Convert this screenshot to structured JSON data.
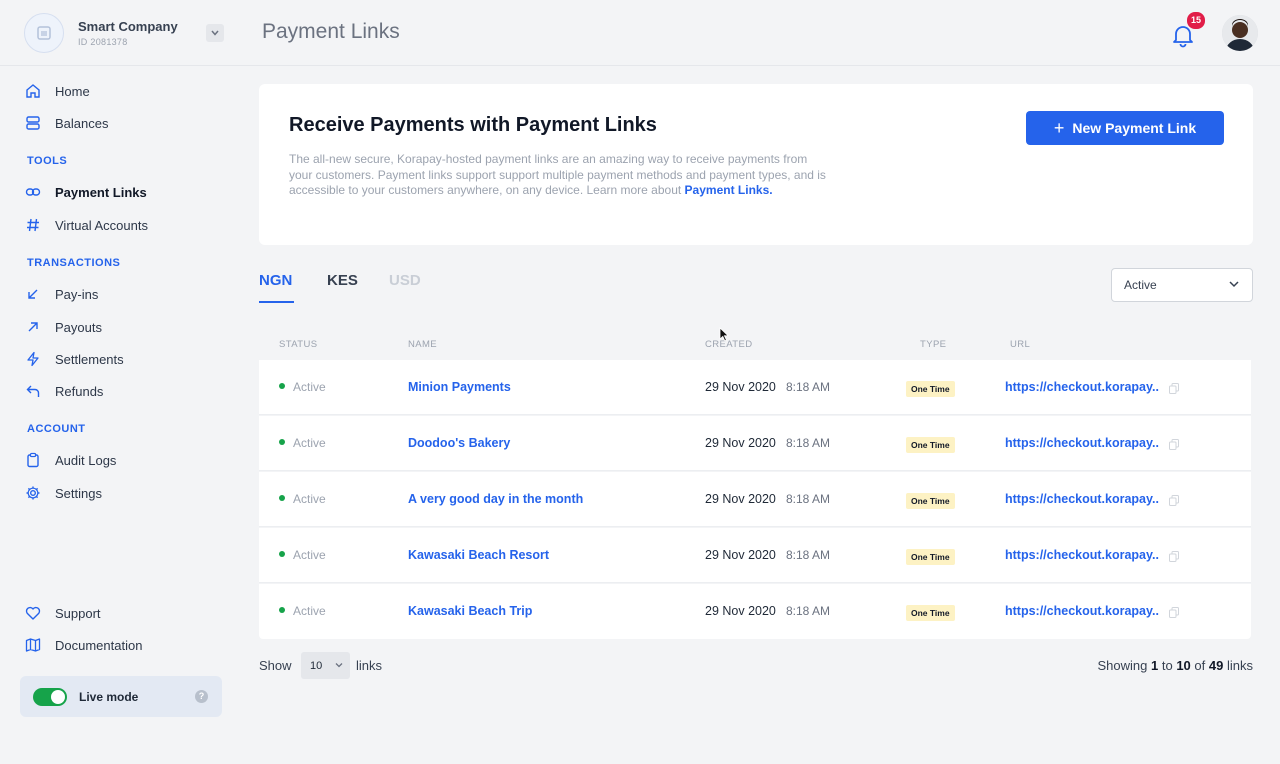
{
  "company": {
    "name": "Smart Company",
    "id": "ID 2081378"
  },
  "page_title": "Payment Links",
  "notifications": {
    "count": "15"
  },
  "sidebar": {
    "main": [
      {
        "label": "Home",
        "icon": "home-icon"
      },
      {
        "label": "Balances",
        "icon": "balances-icon"
      }
    ],
    "tools_heading": "TOOLS",
    "tools": [
      {
        "label": "Payment Links",
        "icon": "link-icon",
        "active": true
      },
      {
        "label": "Virtual Accounts",
        "icon": "hash-icon"
      }
    ],
    "transactions_heading": "TRANSACTIONS",
    "transactions": [
      {
        "label": "Pay-ins",
        "icon": "arrow-down-left-icon"
      },
      {
        "label": "Payouts",
        "icon": "arrow-up-right-icon"
      },
      {
        "label": "Settlements",
        "icon": "lightning-icon"
      },
      {
        "label": "Refunds",
        "icon": "refund-icon"
      }
    ],
    "account_heading": "ACCOUNT",
    "account": [
      {
        "label": "Audit Logs",
        "icon": "clipboard-icon"
      },
      {
        "label": "Settings",
        "icon": "gear-icon"
      }
    ],
    "bottom": [
      {
        "label": "Support",
        "icon": "heart-icon"
      },
      {
        "label": "Documentation",
        "icon": "map-icon"
      }
    ],
    "live_mode": {
      "label": "Live mode",
      "on": true,
      "help": "?"
    }
  },
  "hero": {
    "title": "Receive Payments with Payment Links",
    "description": "The all-new secure, Korapay-hosted payment links are an amazing way to receive payments from your customers. Payment links support support multiple payment methods and payment types, and is accessible to your customers anywhere, on any device. Learn more about ",
    "link_text": "Payment Links.",
    "button_label": "New Payment Link",
    "button_icon": "+"
  },
  "tabs": [
    {
      "label": "NGN",
      "active": true
    },
    {
      "label": "KES",
      "active": false
    },
    {
      "label": "USD",
      "active": false,
      "disabled": true
    }
  ],
  "filter": {
    "value": "Active"
  },
  "table": {
    "headers": [
      "STATUS",
      "NAME",
      "CREATED",
      "TYPE",
      "URL"
    ],
    "rows": [
      {
        "status": "Active",
        "name": "Minion Payments",
        "date": "29 Nov 2020",
        "time": "8:18 AM",
        "type": "One Time",
        "url": "https://checkout.korapay.."
      },
      {
        "status": "Active",
        "name": "Doodoo's Bakery",
        "date": "29 Nov 2020",
        "time": "8:18 AM",
        "type": "One Time",
        "url": "https://checkout.korapay.."
      },
      {
        "status": "Active",
        "name": "A very good day in the month",
        "date": "29 Nov 2020",
        "time": "8:18 AM",
        "type": "One Time",
        "url": "https://checkout.korapay.."
      },
      {
        "status": "Active",
        "name": "Kawasaki Beach Resort",
        "date": "29 Nov 2020",
        "time": "8:18 AM",
        "type": "One Time",
        "url": "https://checkout.korapay.."
      },
      {
        "status": "Active",
        "name": "Kawasaki Beach Trip",
        "date": "29 Nov 2020",
        "time": "8:18 AM",
        "type": "One Time",
        "url": "https://checkout.korapay.."
      }
    ]
  },
  "footer": {
    "show_label": "Show",
    "per_page": "10",
    "links_label": "links",
    "showing_prefix": "Showing",
    "from": "1",
    "to_label": "to",
    "to": "10",
    "of_label": "of",
    "total": "49",
    "suffix": "links"
  },
  "colors": {
    "accent": "#2563eb",
    "active_dot": "#16a34a",
    "badge": "#e11d48",
    "type_bg": "#fdf2c4"
  }
}
